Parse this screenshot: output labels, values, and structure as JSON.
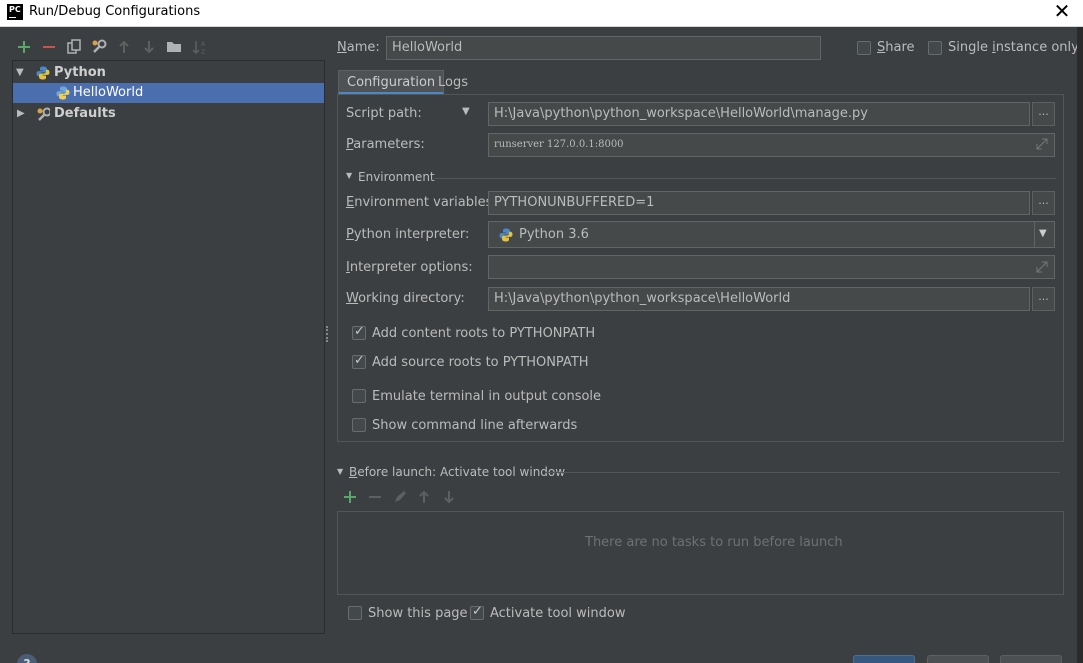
{
  "window": {
    "app_icon_text": "PC",
    "title": "Run/Debug Configurations",
    "close_symbol": "✕"
  },
  "toolbar": {
    "icons": [
      "plus-icon",
      "minus-icon",
      "copy-icon",
      "wrench-icon",
      "arrow-up-icon",
      "arrow-down-icon",
      "folder-icon",
      "sort-icon"
    ]
  },
  "tree": {
    "python_label": "Python",
    "helloworld_label": "HelloWorld",
    "defaults_label": "Defaults"
  },
  "header": {
    "name_label_u": "N",
    "name_label_rest": "ame:",
    "name_value": "HelloWorld",
    "share_u": "S",
    "share_rest": "hare",
    "single_instance_pre": "Single ",
    "single_instance_u": "i",
    "single_instance_rest": "nstance only"
  },
  "tabs": {
    "configuration": "Configuration",
    "logs": "Logs"
  },
  "config": {
    "script_path_label": "Script path:",
    "script_path_value": "H:\\Java\\python\\python_workspace\\HelloWorld\\manage.py",
    "parameters_label_u": "P",
    "parameters_label_rest": "arameters:",
    "parameters_value": "runserver 127.0.0.1:8000",
    "environment_section": "Environment",
    "env_vars_label_u": "E",
    "env_vars_label_rest": "nvironment variables:",
    "env_vars_value": "PYTHONUNBUFFERED=1",
    "interpreter_label_u": "P",
    "interpreter_label_rest": "ython interpreter:",
    "interpreter_value": "Python 3.6",
    "interp_options_label_u": "I",
    "interp_options_label_rest": "nterpreter options:",
    "interp_options_value": "",
    "workdir_label_u": "W",
    "workdir_label_rest": "orking directory:",
    "workdir_value": "H:\\Java\\python\\python_workspace\\HelloWorld",
    "ellipsis": "...",
    "cb_content_roots": "Add content roots to PYTHONPATH",
    "cb_source_roots": "Add source roots to PYTHONPATH",
    "cb_emulate_terminal": "Emulate terminal in output console",
    "cb_show_command": "Show command line afterwards"
  },
  "before_launch": {
    "title_u": "B",
    "title_rest": "efore launch: Activate tool window",
    "empty_text": "There are no tasks to run before launch"
  },
  "footer": {
    "show_page": "Show this page",
    "activate_tool_window": "Activate tool window",
    "help_symbol": "?"
  },
  "colors": {
    "background": "#3c3f41",
    "selection": "#4b6eaf",
    "field": "#45494a",
    "add_green": "#59a869",
    "remove_red": "#c75450",
    "tab_underline": "#4a88c7"
  }
}
